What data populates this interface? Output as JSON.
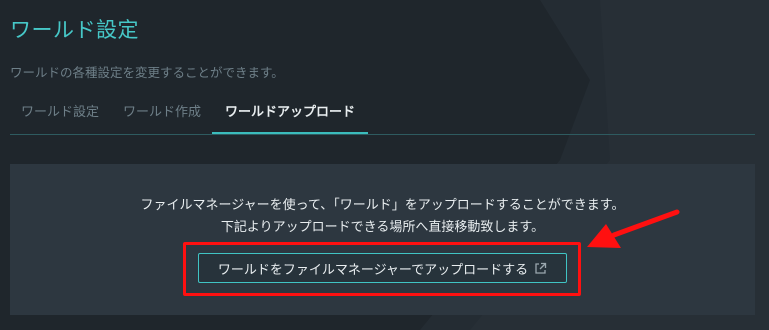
{
  "page": {
    "title": "ワールド設定",
    "subtitle": "ワールドの各種設定を変更することができます。"
  },
  "tabs": [
    {
      "label": "ワールド設定",
      "active": false
    },
    {
      "label": "ワールド作成",
      "active": false
    },
    {
      "label": "ワールドアップロード",
      "active": true
    }
  ],
  "panel": {
    "line1": "ファイルマネージャーを使って、「ワールド」をアップロードすることができます。",
    "line2": "下記よりアップロードできる場所へ直接移動致します。",
    "button_label": "ワールドをファイルマネージャーでアップロードする",
    "button_icon": "external-link-icon"
  },
  "colors": {
    "background": "#1f262c",
    "panel": "#2d3740",
    "accent": "#3bbcbc",
    "highlight": "#ff1010"
  }
}
